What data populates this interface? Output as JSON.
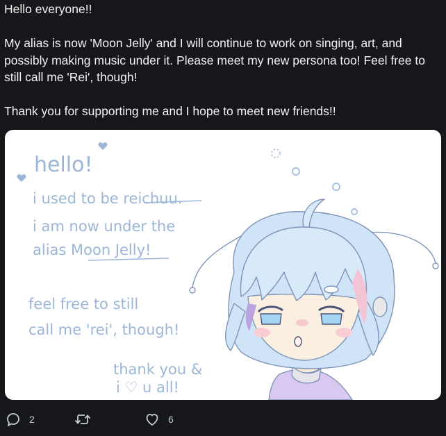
{
  "tweet": {
    "paragraphs": [
      "Hello everyone!!",
      "My alias is now 'Moon Jelly' and I will continue to work on singing, art, and possibly making music under it. Please meet my new persona too! Feel free to still call me 'Rei', though!",
      "Thank you for supporting me and I hope to meet new friends!!"
    ]
  },
  "media": {
    "handwriting": {
      "greeting": "hello!",
      "line1": "i used to be reichuu.",
      "line2": "i am now under the",
      "line3": "alias Moon Jelly!",
      "line4": "feel free to still",
      "line5": "call me 'rei', though!",
      "line6": "thank you &",
      "line7": "i ♡ u all!"
    }
  },
  "actions": {
    "reply": {
      "icon": "reply-icon",
      "count": "2"
    },
    "retweet": {
      "icon": "retweet-icon",
      "count": ""
    },
    "like": {
      "icon": "heart-icon",
      "count": "6"
    }
  },
  "colors": {
    "background": "#15171a",
    "text": "#f2f2f2",
    "icon": "#c8ccd0",
    "handwriting": "#9bb6d8",
    "hair": "#cfe4f7",
    "sweater": "#d9c8ef"
  }
}
